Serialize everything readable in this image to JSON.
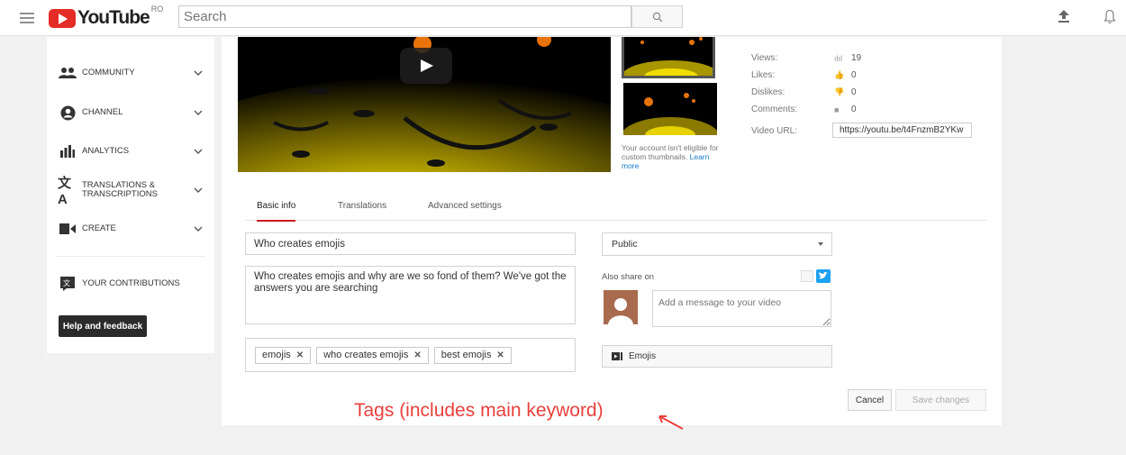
{
  "header": {
    "logo_text": "YouTube",
    "region": "RO",
    "search_placeholder": "Search",
    "icons": [
      "hamburger-icon",
      "search-icon",
      "upload-icon",
      "bell-icon"
    ]
  },
  "sidebar": {
    "items": [
      {
        "label": "COMMUNITY",
        "icon": "community-icon"
      },
      {
        "label": "CHANNEL",
        "icon": "channel-icon"
      },
      {
        "label": "ANALYTICS",
        "icon": "analytics-icon"
      },
      {
        "label": "TRANSLATIONS & TRANSCRIPTIONS",
        "icon": "translate-icon"
      },
      {
        "label": "CREATE",
        "icon": "camera-icon"
      },
      {
        "label": "YOUR CONTRIBUTIONS",
        "icon": "contributions-icon"
      }
    ],
    "help_button": "Help and feedback"
  },
  "video": {
    "thumbnail_note": "Your account isn't eligible for custom thumbnails.",
    "learn_more": "Learn more"
  },
  "stats": {
    "views_label": "Views:",
    "views": "19",
    "likes_label": "Likes:",
    "likes": "0",
    "dislikes_label": "Dislikes:",
    "dislikes": "0",
    "comments_label": "Comments:",
    "comments": "0",
    "url_label": "Video URL:",
    "url": "https://youtu.be/t4FnzmB2YKw"
  },
  "tabs": [
    "Basic info",
    "Translations",
    "Advanced settings"
  ],
  "form": {
    "title": "Who creates emojis",
    "description": "Who creates emojis and why are we so fond of them? We've got the answers you are searching",
    "tags": [
      "emojis",
      "who creates emojis",
      "best emojis"
    ],
    "privacy": "Public",
    "also_share_label": "Also share on",
    "message_placeholder": "Add a message to your video",
    "playlist": "Emojis",
    "cancel": "Cancel",
    "save": "Save changes"
  },
  "annotation": "Tags (includes main keyword)",
  "colors": {
    "brand_red": "#e52d27",
    "tab_underline": "#cc181e",
    "annotation_red": "#e8413c",
    "twitter_blue": "#1da1f2"
  }
}
